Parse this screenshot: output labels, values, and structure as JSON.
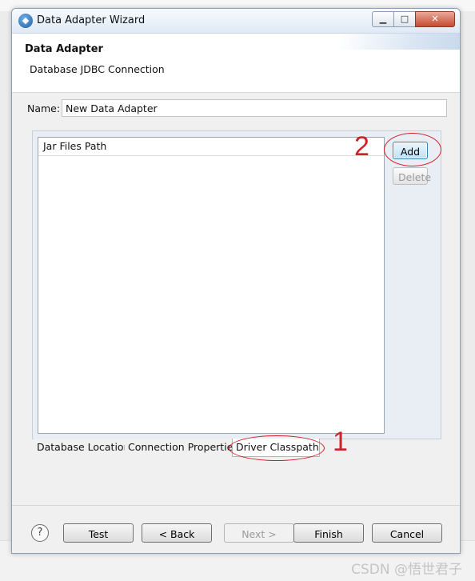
{
  "window": {
    "title": "Data Adapter Wizard",
    "minimize_glyph": "▁",
    "maximize_glyph": "□",
    "close_glyph": "✕"
  },
  "header": {
    "title": "Data Adapter",
    "subtitle": "Database JDBC Connection"
  },
  "name_field": {
    "label": "Name:",
    "value": "New Data Adapter"
  },
  "jar_table": {
    "column_header": "Jar Files Path",
    "rows": []
  },
  "side_buttons": {
    "add": "Add",
    "delete": "Delete"
  },
  "tabs": [
    {
      "label": "Database Location"
    },
    {
      "label": "Connection Properties"
    },
    {
      "label": "Driver Classpath"
    }
  ],
  "active_tab": "Driver Classpath",
  "annotations": {
    "tab_marker": "1",
    "add_marker": "2",
    "color": "#d0202a"
  },
  "footer": {
    "help_glyph": "?",
    "test": "Test",
    "back": "< Back",
    "next": "Next >",
    "finish": "Finish",
    "cancel": "Cancel"
  },
  "watermark": "CSDN @悟世君子",
  "icons": {
    "app": "eclipse-app-icon",
    "help": "help-icon"
  }
}
